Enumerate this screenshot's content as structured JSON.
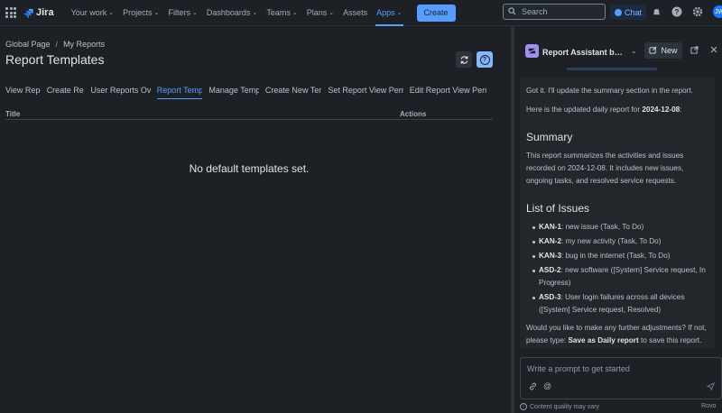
{
  "nav": {
    "logo": "Jira",
    "items": [
      {
        "label": "Your work",
        "chevron": true
      },
      {
        "label": "Projects",
        "chevron": true
      },
      {
        "label": "Filters",
        "chevron": true
      },
      {
        "label": "Dashboards",
        "chevron": true
      },
      {
        "label": "Teams",
        "chevron": true
      },
      {
        "label": "Plans",
        "chevron": true
      },
      {
        "label": "Assets",
        "chevron": false
      },
      {
        "label": "Apps",
        "chevron": true,
        "active": true
      }
    ],
    "create_label": "Create",
    "search_placeholder": "Search",
    "chat_label": "Chat",
    "accent": "#579dff"
  },
  "page": {
    "breadcrumb": [
      "Global Page",
      "My Reports"
    ],
    "title": "Report Templates",
    "tabs": [
      {
        "label": "View Reports",
        "width": 39
      },
      {
        "label": "Create Reports",
        "width": 42
      },
      {
        "label": "User Reports Overview",
        "width": 67
      },
      {
        "label": "Report Templates",
        "width": 51,
        "active": true
      },
      {
        "label": "Manage Templates",
        "width": 56
      },
      {
        "label": "Create New Template",
        "width": 63
      },
      {
        "label": "Set Report View Permissions",
        "width": 84
      },
      {
        "label": "Edit Report View Permissions",
        "width": 86
      }
    ],
    "table": {
      "columns": [
        "Title",
        "Actions"
      ],
      "empty_message": "No default templates set."
    }
  },
  "assistant": {
    "title": "Report Assistant by Si...",
    "new_label": "New",
    "message": {
      "intro": "Got it. I'll update the summary section in the report.",
      "report_line_prefix": "Here is the updated daily report for ",
      "report_date": "2024-12-08",
      "report_line_suffix": ":",
      "summary_heading": "Summary",
      "summary_text": "This report summarizes the activities and issues recorded on 2024-12-08. It includes new issues, ongoing tasks, and resolved service requests.",
      "issues_heading": "List of Issues",
      "issues": [
        {
          "key": "KAN-1",
          "text": ": new issue (Task, To Do)"
        },
        {
          "key": "KAN-2",
          "text": ": my new activity (Task, To Do)"
        },
        {
          "key": "KAN-3",
          "text": ": bug in the internet (Task, To Do)"
        },
        {
          "key": "ASD-2",
          "text": ": new software ([System] Service request, In Progress)"
        },
        {
          "key": "ASD-3",
          "text": ": User login failures across all devices ([System] Service request, Resolved)"
        }
      ],
      "closing_prefix": "Would you like to make any further adjustments? If not, please type: ",
      "closing_action": "Save as Daily report",
      "closing_suffix": " to save this report."
    },
    "prompt_placeholder": "Write a prompt to get started",
    "quality_note": "Content quality may vary",
    "powered_by": "Rovo"
  }
}
